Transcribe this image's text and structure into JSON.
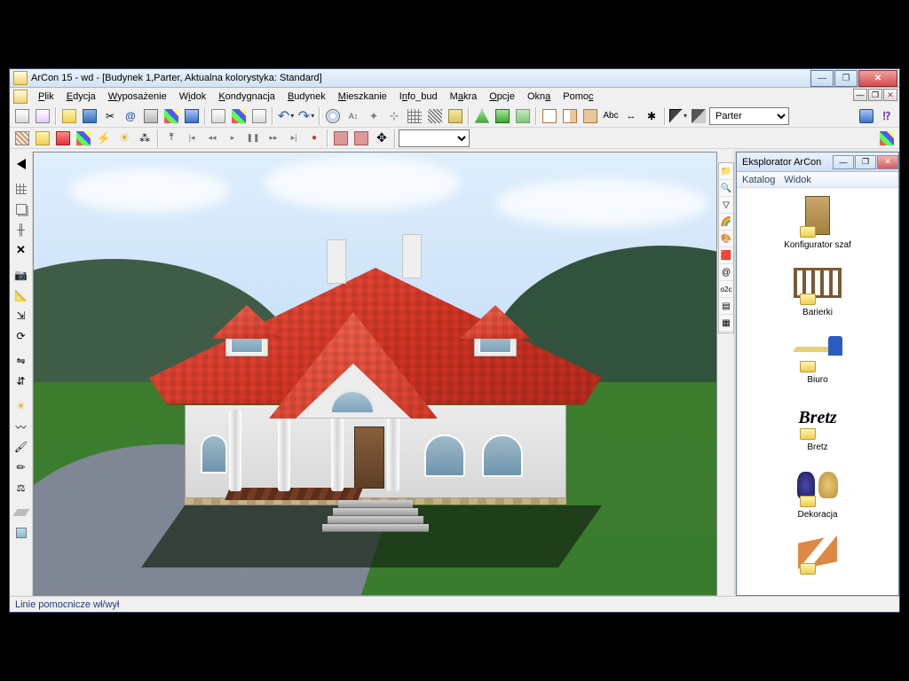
{
  "window": {
    "title": "ArCon 15 - wd - [Budynek 1,Parter, Aktualna kolorystyka: Standard]"
  },
  "menu": {
    "items": [
      "Plik",
      "Edycja",
      "Wyposażenie",
      "Widok",
      "Kondygnacja",
      "Budynek",
      "Mieszkanie",
      "Info_bud",
      "Makra",
      "Opcje",
      "Okna",
      "Pomoc"
    ]
  },
  "toolbar1": {
    "floor_select": "Parter"
  },
  "status": {
    "text": "Linie pomocnicze wł/wył"
  },
  "explorer": {
    "title": "Eksplorator ArCon",
    "menu": [
      "Katalog",
      "Widok"
    ],
    "items": [
      {
        "label": "Konfigurator szaf"
      },
      {
        "label": "Barierki"
      },
      {
        "label": "Biuro"
      },
      {
        "label": "Bretz"
      },
      {
        "label": "Dekoracja"
      }
    ]
  },
  "right_mini": {
    "items": [
      "📁",
      "🔍",
      "▽",
      "🌈",
      "🎨",
      "🟥",
      "@",
      "o2c",
      "▤",
      "▦"
    ]
  }
}
